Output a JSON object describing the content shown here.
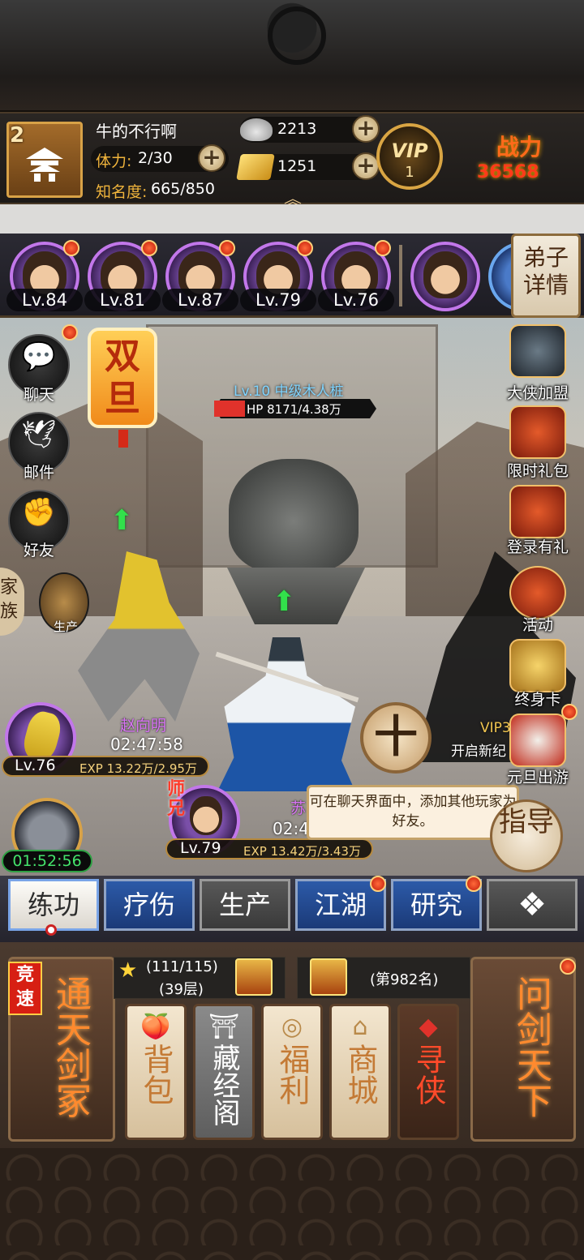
{
  "header": {
    "player_level": "2",
    "player_name": "牛的不行啊",
    "stamina_label": "体力:",
    "stamina_value": "2/30",
    "fame_label": "知名度:",
    "fame_value": "665/850",
    "silver": "2213",
    "gold": "1251",
    "vip_text": "VIP",
    "vip_level": "1",
    "power_label": "战力",
    "power_value": "36568"
  },
  "team": {
    "heroes": [
      {
        "level": "Lv.84"
      },
      {
        "level": "Lv.81"
      },
      {
        "level": "Lv.87"
      },
      {
        "level": "Lv.79"
      },
      {
        "level": "Lv.76"
      }
    ],
    "disciple_button": "弟子详情"
  },
  "left_menu": {
    "chat": "聊天",
    "mail": "邮件",
    "friends": "好友",
    "clan": "家族",
    "produce": "生产"
  },
  "event": {
    "newyear": "双旦"
  },
  "enemy": {
    "name": "Lv.10 中级木人桩",
    "hp": "HP 8171/4.38万",
    "hp_fraction": 0.19
  },
  "allies": [
    {
      "name": "赵向明",
      "timer": "02:47:58",
      "level": "Lv.76",
      "exp": "EXP 13.22万/2.95万"
    },
    {
      "name": "苏",
      "timer": "02:4",
      "level": "Lv.79",
      "exp": "EXP 13.42万/3.43万",
      "tag": "师兄"
    }
  ],
  "timer_pill": "01:52:56",
  "tooltip": "可在聊天界面中，添加其他玩家为好友。",
  "vip_promo": {
    "vip": "VIP3",
    "text": "开启新纪"
  },
  "target_button": "十",
  "guide_button": "指导",
  "right_menu": {
    "hero_join": "大侠加盟",
    "limited_gift": "限时礼包",
    "login_gift": "登录有礼",
    "activity": "活动",
    "lifetime_card": "终身卡",
    "newyear_trip": "元旦出游"
  },
  "tabs": [
    {
      "label": "练功"
    },
    {
      "label": "疗伤"
    },
    {
      "label": "生产"
    },
    {
      "label": "江湖"
    },
    {
      "label": "研究"
    }
  ],
  "bottom": {
    "compete_tag": "竞速",
    "tower_card": "通天剑冢",
    "progress": "(111/115)",
    "floor": "(39层)",
    "rank": "(第982名)",
    "pvp_card": "问剑天下",
    "cards": [
      {
        "label": "背包"
      },
      {
        "label": "藏经阁"
      },
      {
        "label": "福利"
      },
      {
        "label": "商城"
      },
      {
        "label": "寻侠"
      }
    ]
  }
}
